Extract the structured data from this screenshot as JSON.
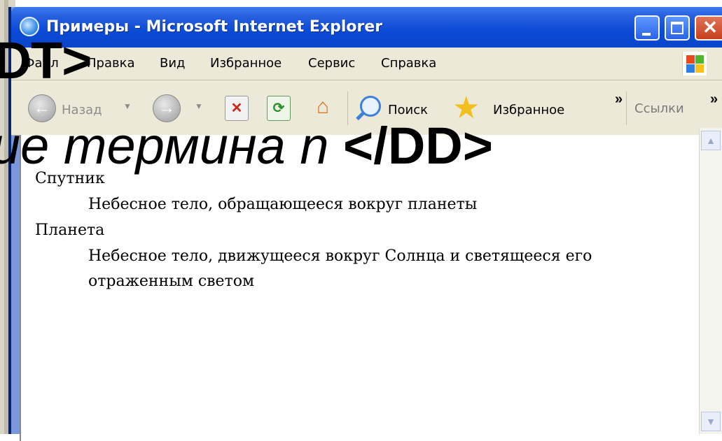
{
  "window": {
    "title": "Примеры - Microsoft Internet Explorer",
    "icon": "internet-explorer-icon",
    "controls": [
      "minimize-icon",
      "maximize-icon",
      "close-icon"
    ]
  },
  "menubar": {
    "items": [
      "Файл",
      "Правка",
      "Вид",
      "Избранное",
      "Сервис",
      "Справка"
    ]
  },
  "toolbar": {
    "back_label": "Назад",
    "search_label": "Поиск",
    "favorites_label": "Избранное",
    "links_label": "Ссылки",
    "more": "»"
  },
  "content": {
    "definitions": [
      {
        "term": "Спутник",
        "description": "Небесное тело, обращающееся вокруг планеты"
      },
      {
        "term": "Планета",
        "description": "Небесное тело, движущееся вокруг Солнца и светящееся его отраженным светом"
      }
    ]
  },
  "overlay": {
    "line1": "/DT>",
    "line2_italic": "ие термина n",
    "line2_bold": "</DD>"
  },
  "colors": {
    "titlebar": "#0a4ad6",
    "chrome": "#ece9d8",
    "close_button": "#c8401d"
  }
}
